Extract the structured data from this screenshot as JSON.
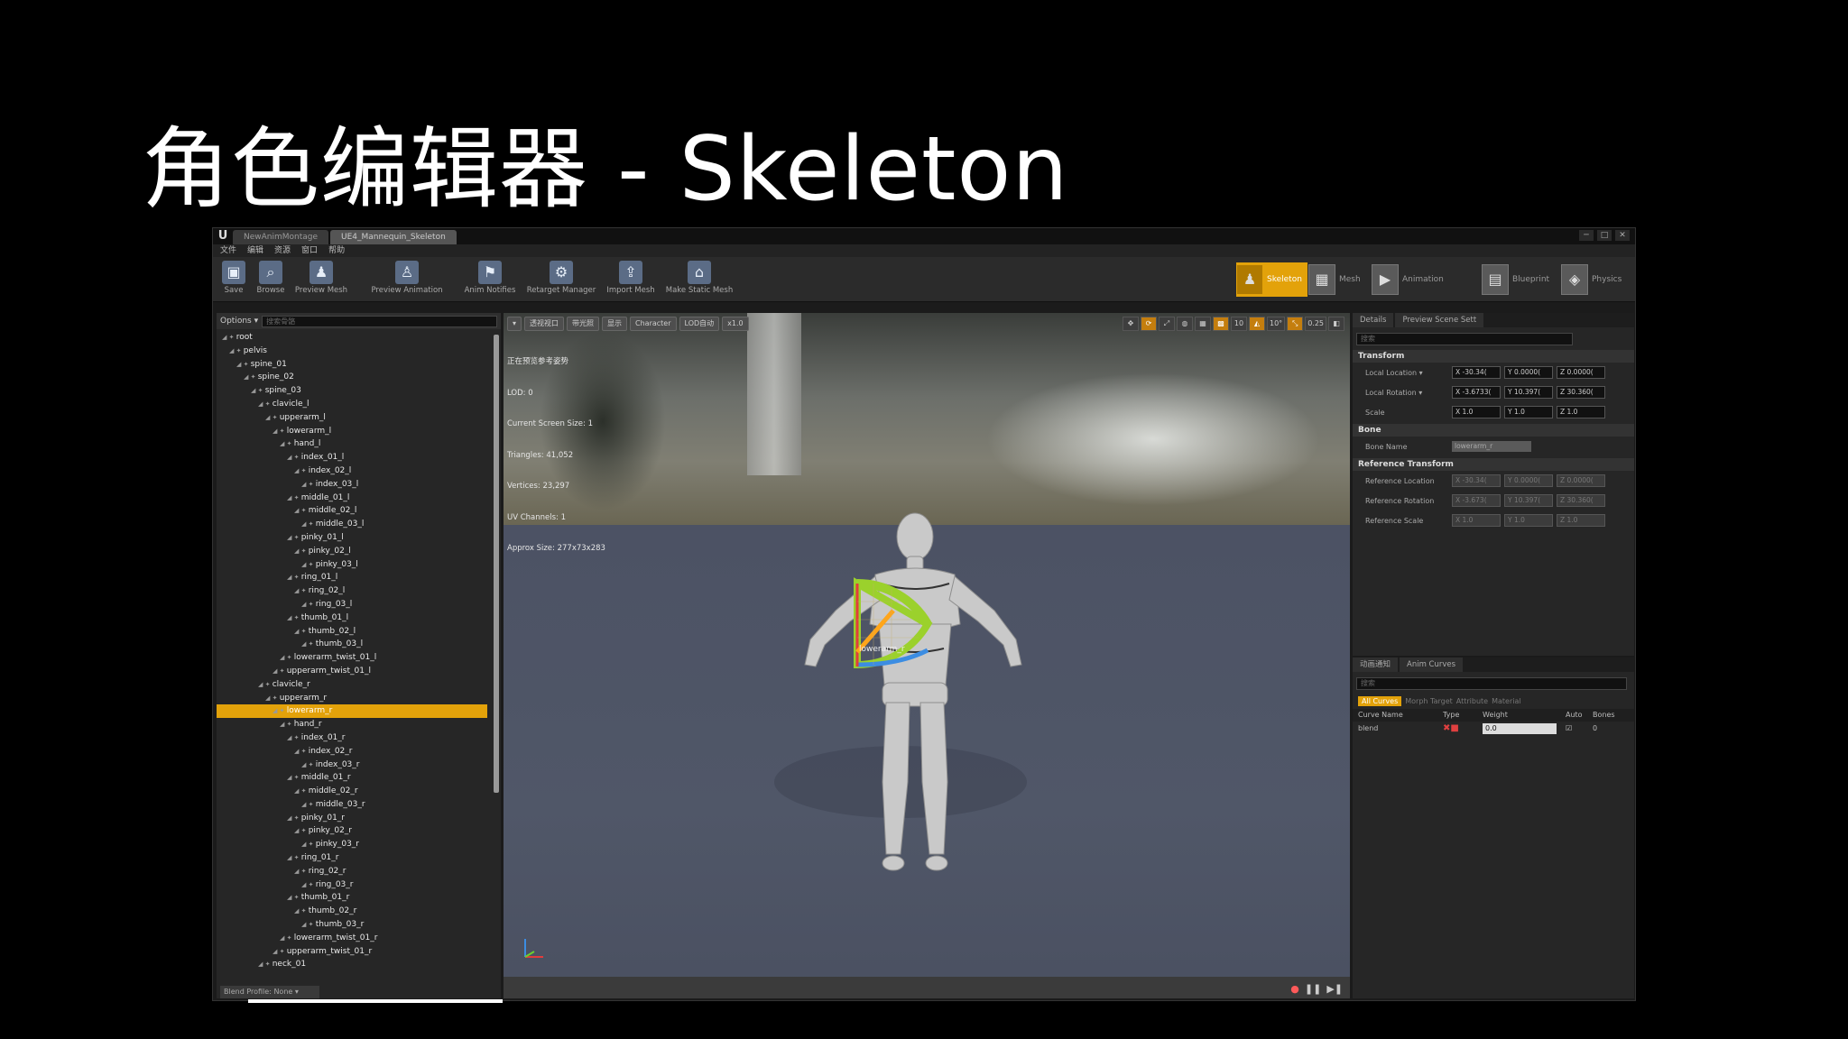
{
  "slide": {
    "title": "角色编辑器 - Skeleton"
  },
  "titlebar": {
    "logo": "U",
    "tabs": [
      "NewAnimMontage",
      "UE4_Mannequin_Skeleton"
    ],
    "window_controls": [
      "─",
      "□",
      "✕"
    ]
  },
  "menubar": {
    "items": [
      "文件",
      "编辑",
      "资源",
      "窗口",
      "帮助"
    ]
  },
  "toolbar": {
    "buttons": [
      {
        "label": "Save",
        "icon": "save-icon",
        "glyph": "▣"
      },
      {
        "label": "Browse",
        "icon": "browse-icon",
        "glyph": "⌕"
      },
      {
        "label": "Preview Mesh",
        "icon": "preview-mesh-icon",
        "glyph": "♟"
      },
      {
        "label": "Preview Animation",
        "icon": "preview-animation-icon",
        "glyph": "♙"
      },
      {
        "label": "Anim Notifies",
        "icon": "anim-notifies-icon",
        "glyph": "⚑"
      },
      {
        "label": "Retarget Manager",
        "icon": "retarget-manager-icon",
        "glyph": "⚙"
      },
      {
        "label": "Import Mesh",
        "icon": "import-mesh-icon",
        "glyph": "⇪"
      },
      {
        "label": "Make Static Mesh",
        "icon": "make-static-mesh-icon",
        "glyph": "⌂"
      }
    ],
    "modes": [
      {
        "label": "Skeleton",
        "glyph": "♟"
      },
      {
        "label": "Mesh",
        "glyph": "▦"
      },
      {
        "label": "Animation",
        "glyph": "▶"
      },
      {
        "label": "Blueprint",
        "glyph": "▤"
      },
      {
        "label": "Physics",
        "glyph": "◈"
      }
    ]
  },
  "skeleton_tree": {
    "options_label": "Options ▾",
    "search_placeholder": "搜索骨骼",
    "footer": "Blend Profile: None ▾",
    "selected": "lowerarm_r",
    "bones": [
      {
        "name": "root",
        "depth": 0
      },
      {
        "name": "pelvis",
        "depth": 1
      },
      {
        "name": "spine_01",
        "depth": 2
      },
      {
        "name": "spine_02",
        "depth": 3
      },
      {
        "name": "spine_03",
        "depth": 4
      },
      {
        "name": "clavicle_l",
        "depth": 5
      },
      {
        "name": "upperarm_l",
        "depth": 6
      },
      {
        "name": "lowerarm_l",
        "depth": 7
      },
      {
        "name": "hand_l",
        "depth": 8
      },
      {
        "name": "index_01_l",
        "depth": 9
      },
      {
        "name": "index_02_l",
        "depth": 10
      },
      {
        "name": "index_03_l",
        "depth": 11
      },
      {
        "name": "middle_01_l",
        "depth": 9
      },
      {
        "name": "middle_02_l",
        "depth": 10
      },
      {
        "name": "middle_03_l",
        "depth": 11
      },
      {
        "name": "pinky_01_l",
        "depth": 9
      },
      {
        "name": "pinky_02_l",
        "depth": 10
      },
      {
        "name": "pinky_03_l",
        "depth": 11
      },
      {
        "name": "ring_01_l",
        "depth": 9
      },
      {
        "name": "ring_02_l",
        "depth": 10
      },
      {
        "name": "ring_03_l",
        "depth": 11
      },
      {
        "name": "thumb_01_l",
        "depth": 9
      },
      {
        "name": "thumb_02_l",
        "depth": 10
      },
      {
        "name": "thumb_03_l",
        "depth": 11
      },
      {
        "name": "lowerarm_twist_01_l",
        "depth": 8
      },
      {
        "name": "upperarm_twist_01_l",
        "depth": 7
      },
      {
        "name": "clavicle_r",
        "depth": 5
      },
      {
        "name": "upperarm_r",
        "depth": 6
      },
      {
        "name": "lowerarm_r",
        "depth": 7
      },
      {
        "name": "hand_r",
        "depth": 8
      },
      {
        "name": "index_01_r",
        "depth": 9
      },
      {
        "name": "index_02_r",
        "depth": 10
      },
      {
        "name": "index_03_r",
        "depth": 11
      },
      {
        "name": "middle_01_r",
        "depth": 9
      },
      {
        "name": "middle_02_r",
        "depth": 10
      },
      {
        "name": "middle_03_r",
        "depth": 11
      },
      {
        "name": "pinky_01_r",
        "depth": 9
      },
      {
        "name": "pinky_02_r",
        "depth": 10
      },
      {
        "name": "pinky_03_r",
        "depth": 11
      },
      {
        "name": "ring_01_r",
        "depth": 9
      },
      {
        "name": "ring_02_r",
        "depth": 10
      },
      {
        "name": "ring_03_r",
        "depth": 11
      },
      {
        "name": "thumb_01_r",
        "depth": 9
      },
      {
        "name": "thumb_02_r",
        "depth": 10
      },
      {
        "name": "thumb_03_r",
        "depth": 11
      },
      {
        "name": "lowerarm_twist_01_r",
        "depth": 8
      },
      {
        "name": "upperarm_twist_01_r",
        "depth": 7
      },
      {
        "name": "neck_01",
        "depth": 5
      }
    ]
  },
  "viewport": {
    "toolbar": [
      "▾",
      "透视视口",
      "带光照",
      "显示",
      "Character",
      "LOD自动",
      "x1.0"
    ],
    "tools": [
      {
        "label": "✥",
        "hot": false
      },
      {
        "label": "⟳",
        "hot": true
      },
      {
        "label": "⤢",
        "hot": false
      },
      {
        "label": "◍",
        "hot": false
      },
      {
        "label": "▦",
        "hot": false
      },
      {
        "label": "▩",
        "hot": true
      },
      {
        "label": "10",
        "hot": false
      },
      {
        "label": "◭",
        "hot": true
      },
      {
        "label": "10°",
        "hot": false
      },
      {
        "label": "⤡",
        "hot": true
      },
      {
        "label": "0.25",
        "hot": false
      },
      {
        "label": "◧",
        "hot": false
      }
    ],
    "stats": [
      "正在预览参考姿势",
      "LOD: 0",
      "Current Screen Size: 1",
      "Triangles: 41,052",
      "Vertices: 23,297",
      "UV Channels: 1",
      "Approx Size: 277x73x283"
    ],
    "bone_label": "lowerarm_r",
    "playback": [
      "●",
      "❚❚",
      "▶❚"
    ]
  },
  "details": {
    "tabs": [
      "Details",
      "Preview Scene Sett"
    ],
    "search_placeholder": "搜索",
    "sections": [
      {
        "title": "Transform",
        "rows": [
          {
            "label": "Local Location ▾",
            "values": [
              "X -30.34(",
              "Y 0.0000(",
              "Z 0.0000("
            ]
          },
          {
            "label": "Local Rotation ▾",
            "values": [
              "X -3.6733(",
              "Y 10.397(",
              "Z 30.360("
            ]
          },
          {
            "label": "Scale",
            "values": [
              "X 1.0",
              "Y 1.0",
              "Z 1.0"
            ]
          }
        ]
      },
      {
        "title": "Bone",
        "bone_name_label": "Bone Name",
        "bone_name_value": "lowerarm_r"
      },
      {
        "title": "Reference Transform",
        "rows": [
          {
            "label": "Reference Location",
            "values": [
              "X -30.34(",
              "Y 0.0000(",
              "Z 0.0000("
            ]
          },
          {
            "label": "Reference Rotation",
            "values": [
              "X -3.673(",
              "Y 10.397(",
              "Z 30.360("
            ]
          },
          {
            "label": "Reference Scale",
            "values": [
              "X 1.0",
              "Y 1.0",
              "Z 1.0"
            ]
          }
        ]
      }
    ]
  },
  "curves": {
    "tabs": [
      "动画通知",
      "Anim Curves"
    ],
    "search_placeholder": "搜索",
    "filters": [
      "All Curves",
      "Morph Target",
      "Attribute",
      "Material"
    ],
    "columns": [
      "Curve Name",
      "Type",
      "Weight",
      "Auto",
      "Bones"
    ],
    "rows": [
      {
        "name": "blend",
        "weight": "0.0",
        "bones": "0"
      }
    ]
  },
  "colors": {
    "accent": "#e3a20a",
    "panel": "#262626",
    "floor": "#505768"
  }
}
